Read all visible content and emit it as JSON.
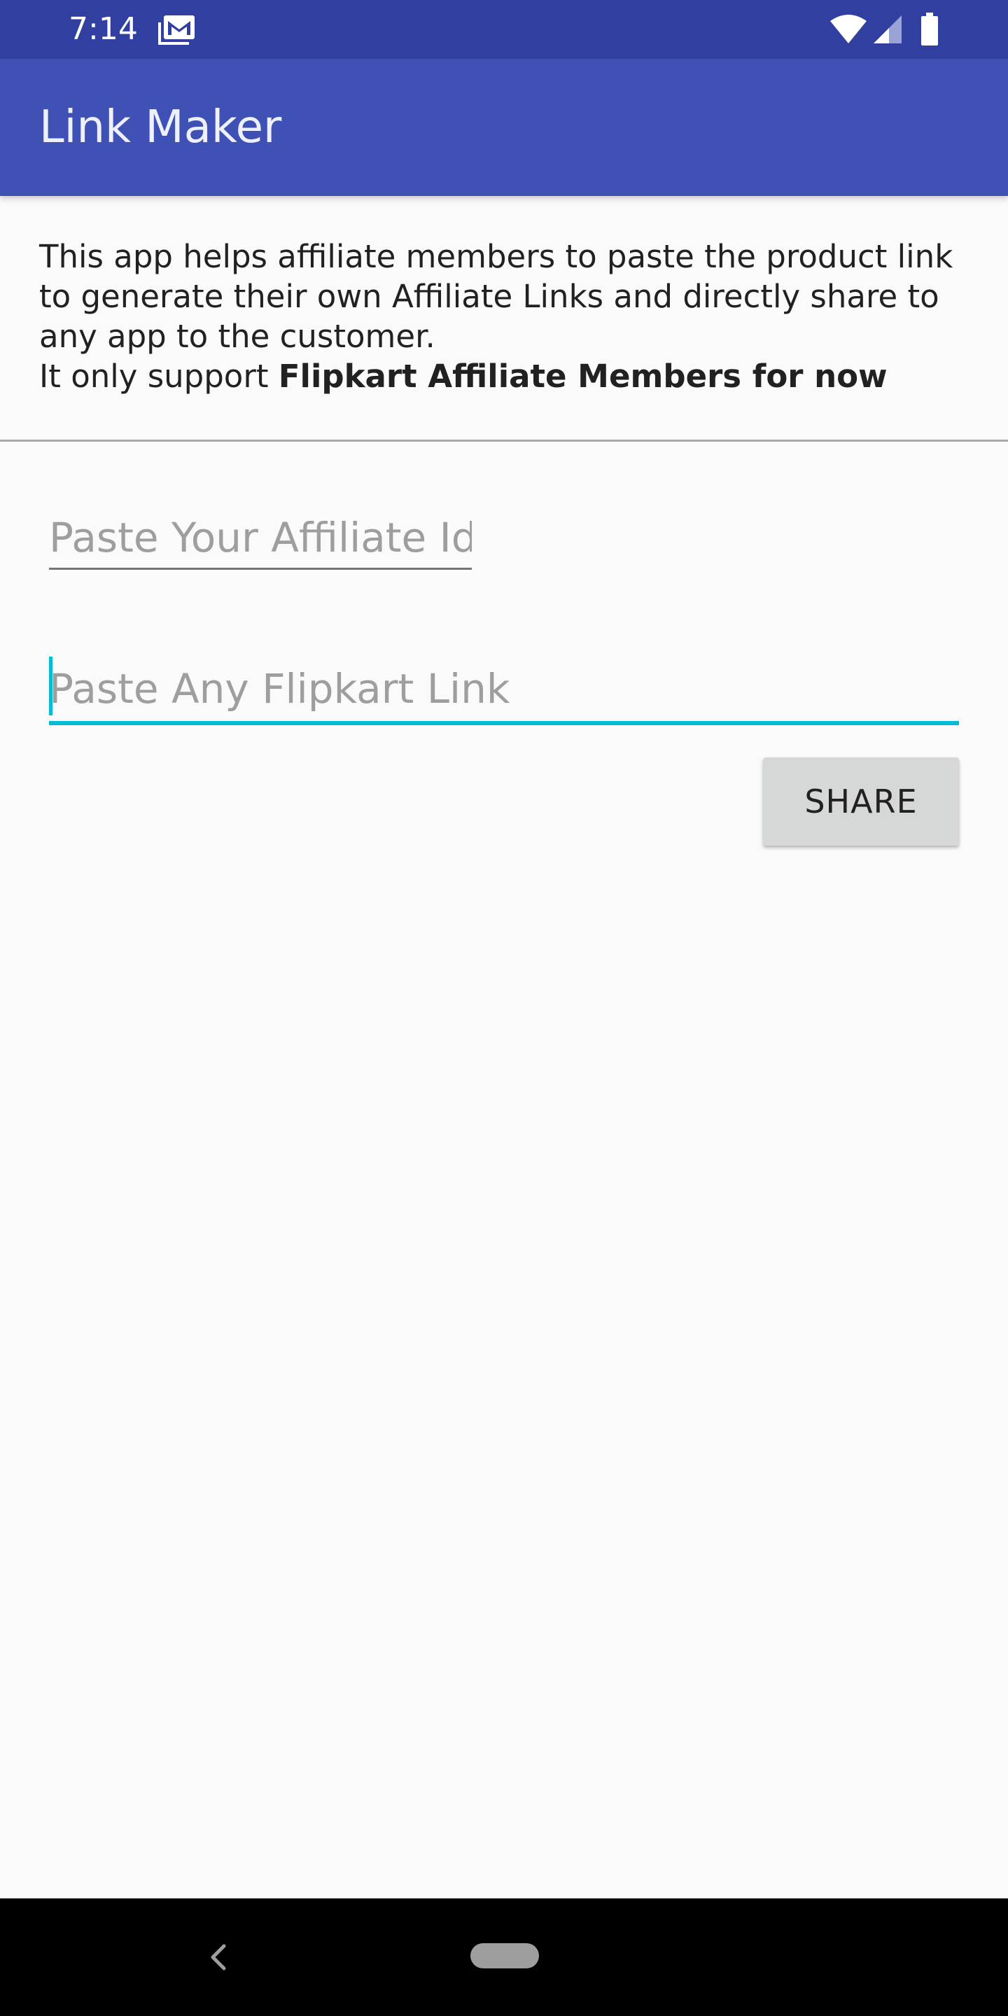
{
  "status_bar": {
    "time": "7:14",
    "icons": [
      "gmail-icon",
      "wifi-icon",
      "signal-icon",
      "battery-icon"
    ]
  },
  "app_bar": {
    "title": "Link Maker",
    "background_color": "#3f51b5",
    "status_bar_color": "#3140a0"
  },
  "description": {
    "line_intro": "This app helps affiliate members to paste the product link to generate their own Affiliate Links and directly share to any app to the customer.",
    "support_prefix": "It only support ",
    "support_bold": "Flipkart Affiliate Members for now"
  },
  "form": {
    "affiliate_id": {
      "value": "",
      "placeholder": "Paste Your Affiliate Id"
    },
    "flipkart_link": {
      "value": "",
      "placeholder": "Paste Any Flipkart Link",
      "focused": true
    },
    "share_label": "SHARE",
    "accent_color": "#00bcd4"
  },
  "nav_bar": {
    "icons": [
      "back-icon",
      "home-pill"
    ]
  }
}
